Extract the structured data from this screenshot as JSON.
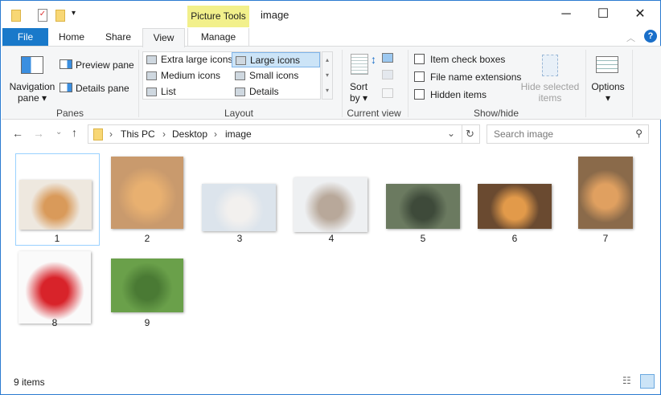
{
  "window": {
    "title": "image",
    "context_tab": "Picture Tools"
  },
  "tabs": [
    {
      "label": "File"
    },
    {
      "label": "Home"
    },
    {
      "label": "Share"
    },
    {
      "label": "View"
    },
    {
      "label": "Manage"
    }
  ],
  "ribbon": {
    "panes": {
      "navigation": "Navigation",
      "navigation2": "pane",
      "preview": "Preview pane",
      "details": "Details pane",
      "label": "Panes"
    },
    "layout": {
      "items": [
        "Extra large icons",
        "Large icons",
        "Medium icons",
        "Small icons",
        "List",
        "Details"
      ],
      "selected": "Large icons",
      "label": "Layout"
    },
    "current_view": {
      "sort": "Sort",
      "sort2": "by",
      "label": "Current view"
    },
    "show_hide": {
      "checkboxes": [
        {
          "label": "Item check boxes",
          "checked": false
        },
        {
          "label": "File name extensions",
          "checked": false
        },
        {
          "label": "Hidden items",
          "checked": false
        }
      ],
      "hide_selected": "Hide selected",
      "hide_selected2": "items",
      "label": "Show/hide"
    },
    "options": "Options"
  },
  "address": {
    "path": [
      "This PC",
      "Desktop",
      "image"
    ],
    "search_placeholder": "Search image"
  },
  "files": [
    {
      "name": "1",
      "colors": [
        "#eee8df",
        "#d99a5a"
      ]
    },
    {
      "name": "2",
      "colors": [
        "#c99a6d",
        "#e8b070"
      ]
    },
    {
      "name": "3",
      "colors": [
        "#dce4ec",
        "#f2f0ee"
      ]
    },
    {
      "name": "4",
      "colors": [
        "#eef0f2",
        "#b8a89a"
      ]
    },
    {
      "name": "5",
      "colors": [
        "#6b7a60",
        "#3e4a3a"
      ]
    },
    {
      "name": "6",
      "colors": [
        "#6a4a30",
        "#e29a4a"
      ]
    },
    {
      "name": "7",
      "colors": [
        "#8a6a4a",
        "#e0a060"
      ]
    },
    {
      "name": "8",
      "colors": [
        "#fafafa",
        "#d8232a"
      ]
    },
    {
      "name": "9",
      "colors": [
        "#6aa04a",
        "#4a7a34"
      ]
    }
  ],
  "status": {
    "count": "9 items"
  }
}
